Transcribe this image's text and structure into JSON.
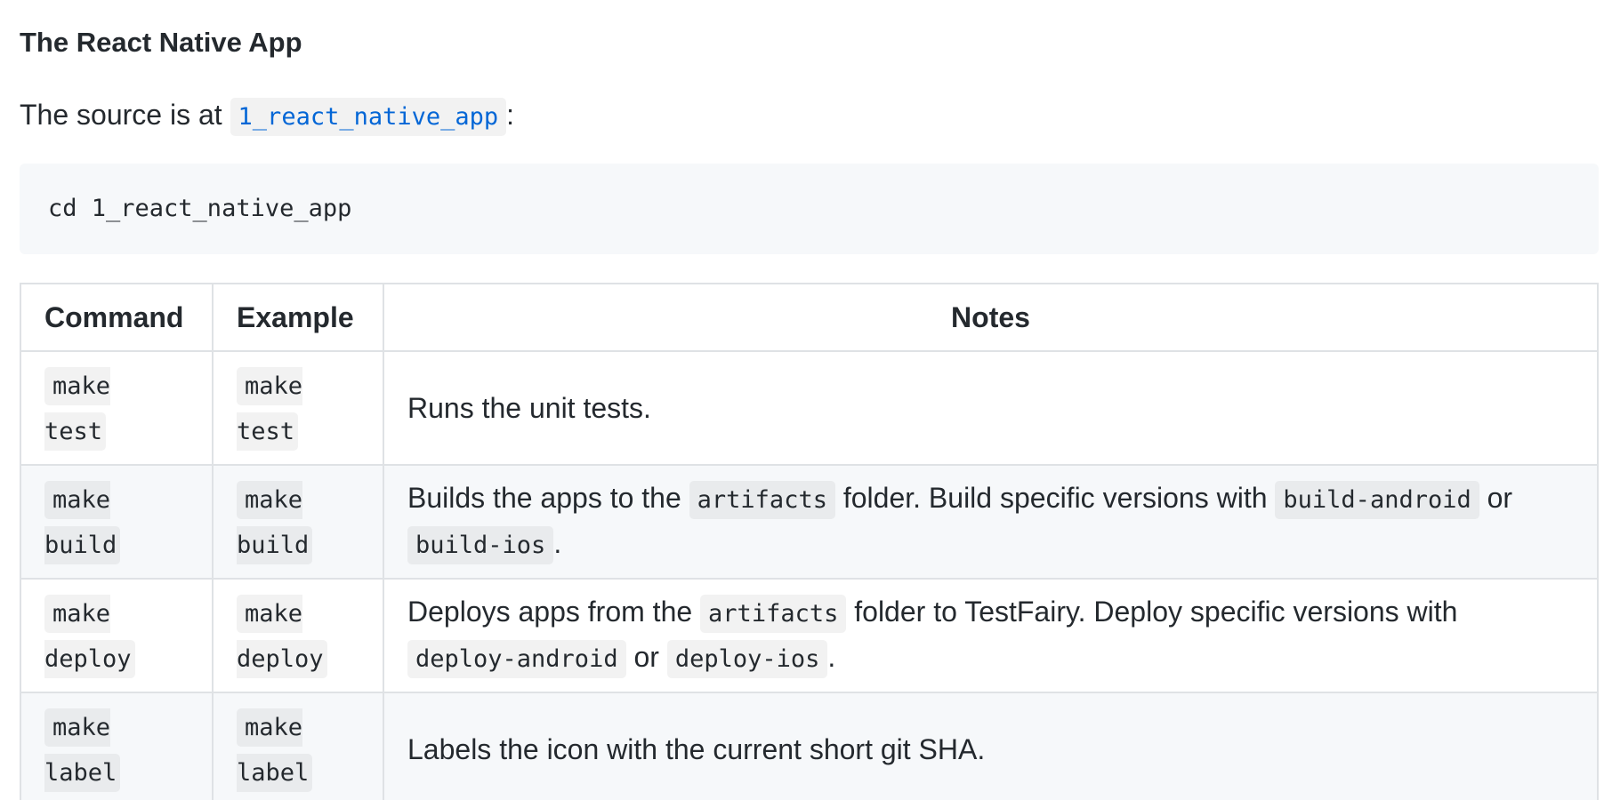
{
  "heading": "The React Native App",
  "source": {
    "prefix": "The source is at",
    "link_text": "1_react_native_app",
    "suffix": ":"
  },
  "code_block": "cd 1_react_native_app",
  "table": {
    "headers": [
      "Command",
      "Example",
      "Notes"
    ],
    "rows": [
      {
        "command_a": "make",
        "command_b": "test",
        "example_a": "make",
        "example_b": "test",
        "notes_text": "Runs the unit tests."
      },
      {
        "command_a": "make",
        "command_b": "build",
        "example_a": "make",
        "example_b": "build",
        "notes_p1": "Builds the apps to the",
        "notes_c1": "artifacts",
        "notes_p2": "folder. Build specific versions with",
        "notes_c2": "build-android",
        "notes_p3": "or",
        "notes_c3": "build-ios",
        "notes_p4": "."
      },
      {
        "command_a": "make",
        "command_b": "deploy",
        "example_a": "make",
        "example_b": "deploy",
        "notes_p1": "Deploys apps from the",
        "notes_c1": "artifacts",
        "notes_p2": "folder to TestFairy. Deploy specific versions with",
        "notes_c2": "deploy-android",
        "notes_p3": "or",
        "notes_c3": "deploy-ios",
        "notes_p4": "."
      },
      {
        "command_a": "make",
        "command_b": "label",
        "example_a": "make",
        "example_b": "label",
        "notes_text": "Labels the icon with the current short git SHA."
      }
    ]
  }
}
